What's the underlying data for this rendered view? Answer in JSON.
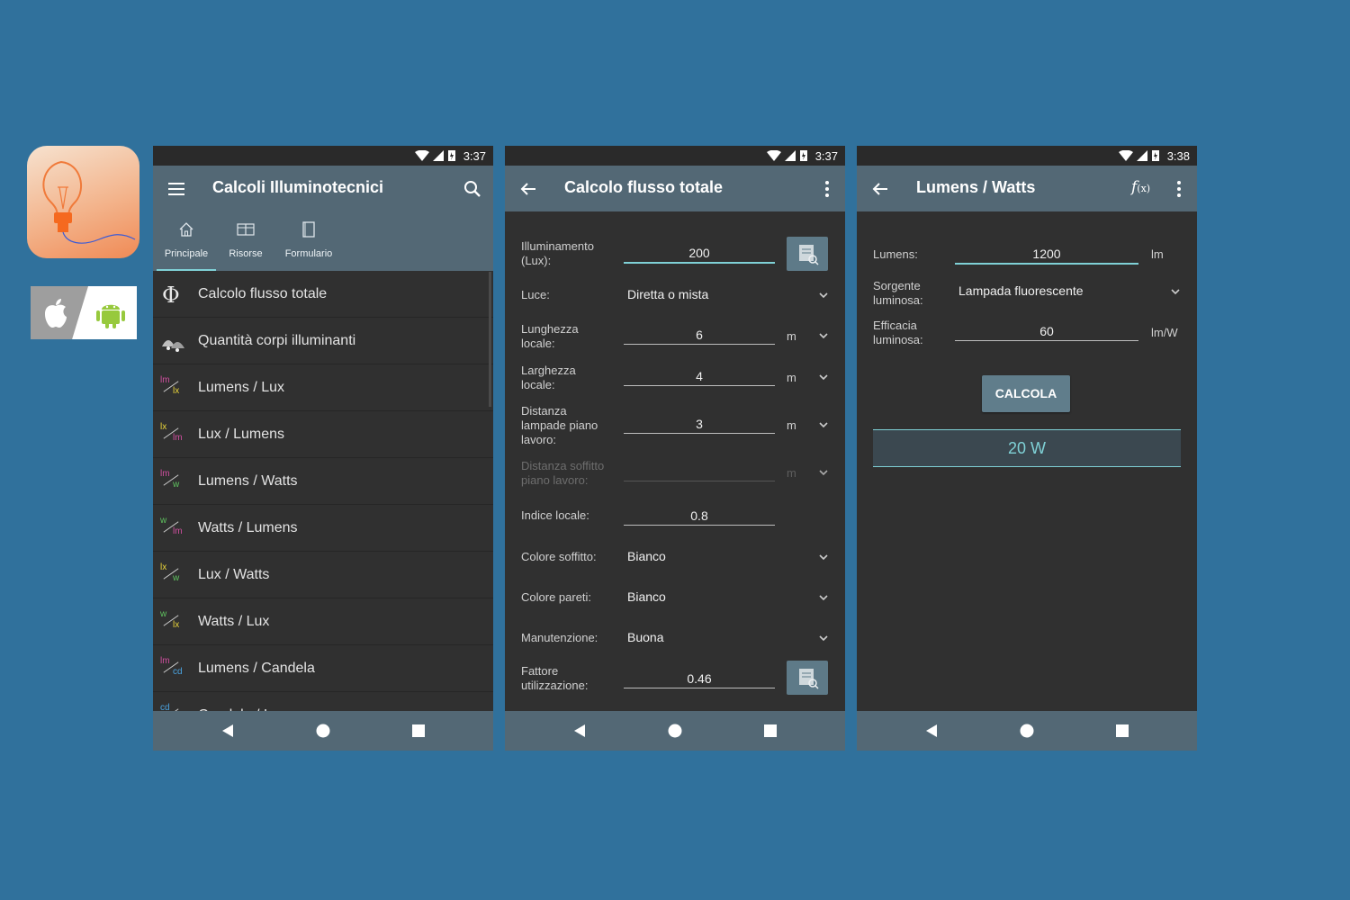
{
  "colors": {
    "background": "#30719c",
    "appbar": "#536875",
    "panel": "#303030",
    "accent": "#7fd1d6"
  },
  "phone1": {
    "time": "3:37",
    "title": "Calcoli Illuminotecnici",
    "tabs": [
      "Principale",
      "Risorse",
      "Formulario"
    ],
    "active_tab": "Principale",
    "items": [
      {
        "label": "Calcolo flusso totale",
        "icon": "phi-icon"
      },
      {
        "label": "Quantità corpi illuminanti",
        "icon": "lamp-icon",
        "a": "",
        "b": ""
      },
      {
        "label": "Lumens / Lux",
        "a": "lm",
        "b": "lx",
        "ca": "#d04fa0",
        "cb": "#e8d43a"
      },
      {
        "label": "Lux / Lumens",
        "a": "lx",
        "b": "lm",
        "ca": "#e8d43a",
        "cb": "#d04fa0"
      },
      {
        "label": "Lumens / Watts",
        "a": "lm",
        "b": "w",
        "ca": "#d04fa0",
        "cb": "#5fc25f"
      },
      {
        "label": "Watts / Lumens",
        "a": "w",
        "b": "lm",
        "ca": "#5fc25f",
        "cb": "#d04fa0"
      },
      {
        "label": "Lux / Watts",
        "a": "lx",
        "b": "w",
        "ca": "#e8d43a",
        "cb": "#5fc25f"
      },
      {
        "label": "Watts / Lux",
        "a": "w",
        "b": "lx",
        "ca": "#5fc25f",
        "cb": "#e8d43a"
      },
      {
        "label": "Lumens / Candela",
        "a": "lm",
        "b": "cd",
        "ca": "#d04fa0",
        "cb": "#4aa3e0"
      },
      {
        "label": "Candela / Lumens",
        "a": "cd",
        "b": "lm",
        "ca": "#4aa3e0",
        "cb": "#d04fa0"
      }
    ]
  },
  "phone2": {
    "time": "3:37",
    "title": "Calcolo flusso totale",
    "fields": {
      "illuminamento": {
        "label": "Illuminamento (Lux):",
        "value": "200"
      },
      "luce": {
        "label": "Luce:",
        "value": "Diretta o mista"
      },
      "lunghezza": {
        "label": "Lunghezza locale:",
        "value": "6",
        "unit": "m"
      },
      "larghezza": {
        "label": "Larghezza locale:",
        "value": "4",
        "unit": "m"
      },
      "distanza_lampade": {
        "label": "Distanza lampade piano lavoro:",
        "value": "3",
        "unit": "m"
      },
      "distanza_soffitto": {
        "label": "Distanza soffitto piano lavoro:",
        "value": "",
        "unit": "m"
      },
      "indice": {
        "label": "Indice locale:",
        "value": "0.8"
      },
      "colore_soffitto": {
        "label": "Colore soffitto:",
        "value": "Bianco"
      },
      "colore_pareti": {
        "label": "Colore pareti:",
        "value": "Bianco"
      },
      "manutenzione": {
        "label": "Manutenzione:",
        "value": "Buona"
      },
      "fattore": {
        "label": "Fattore utilizzazione:",
        "value": "0.46"
      }
    }
  },
  "phone3": {
    "time": "3:38",
    "title": "Lumens / Watts",
    "fields": {
      "lumens": {
        "label": "Lumens:",
        "value": "1200",
        "unit": "lm"
      },
      "sorgente": {
        "label": "Sorgente luminosa:",
        "value": "Lampada fluorescente"
      },
      "efficacia": {
        "label": "Efficacia luminosa:",
        "value": "60",
        "unit": "lm/W"
      }
    },
    "button": "CALCOLA",
    "result": "20 W"
  }
}
